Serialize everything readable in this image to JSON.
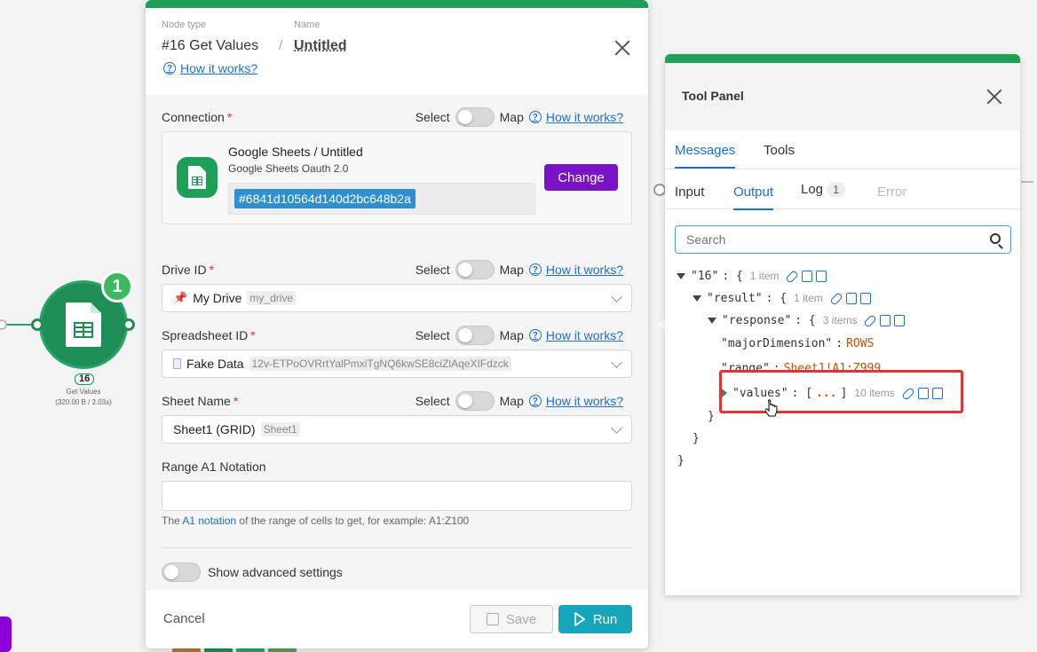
{
  "node": {
    "badge": "1",
    "id": "16",
    "name": "Get Values",
    "meta": "(320.00 B / 2.03s)"
  },
  "modal": {
    "node_type_label": "Node type",
    "name_label": "Name",
    "node_type": "#16 Get Values",
    "name": "Untitled",
    "help": "How it works?",
    "select_label": "Select",
    "map_label": "Map",
    "connection": {
      "label": "Connection",
      "title": "Google Sheets / Untitled",
      "subtitle": "Google Sheets Oauth 2.0",
      "id": "#6841d10564d140d2bc648b2a",
      "change": "Change"
    },
    "drive": {
      "label": "Drive ID",
      "value": "My Drive",
      "chip": "my_drive"
    },
    "spreadsheet": {
      "label": "Spreadsheet ID",
      "value": "Fake Data",
      "chip": "12v-ETPoOVRrtYalPmxiTgNQ6kwSE8ciZlAqeXIFdzck"
    },
    "sheet": {
      "label": "Sheet Name",
      "value": "Sheet1 (GRID)",
      "chip": "Sheet1"
    },
    "range": {
      "label": "Range A1 Notation",
      "value": "",
      "hint_pre": "The ",
      "hint_link": "A1 notation",
      "hint_post": " of the range of cells to get, for example: A1:Z100"
    },
    "advanced": "Show advanced settings",
    "cancel": "Cancel",
    "save": "Save",
    "run": "Run"
  },
  "tool_panel": {
    "title": "Tool Panel",
    "tabs": [
      "Messages",
      "Tools"
    ],
    "subtabs": {
      "input": "Input",
      "output": "Output",
      "log": "Log",
      "log_count": "1",
      "error": "Error"
    },
    "search_placeholder": "Search",
    "tree": {
      "root_key": "\"16\"",
      "root_meta": "1 item",
      "result_key": "\"result\"",
      "result_meta": "1 item",
      "response_key": "\"response\"",
      "response_meta": "3 items",
      "major_key": "\"majorDimension\"",
      "major_val": "ROWS",
      "range_key": "\"range\"",
      "range_val": "Sheet1!A1:Z999",
      "values_key": "\"values\"",
      "values_val": "...",
      "values_meta": "10 items"
    }
  },
  "colors": {
    "green": "#1e9e56",
    "purple": "#7a12c6",
    "blue": "#1f6fd1",
    "teal": "#17a5b9",
    "highlight": "#e0343a"
  }
}
